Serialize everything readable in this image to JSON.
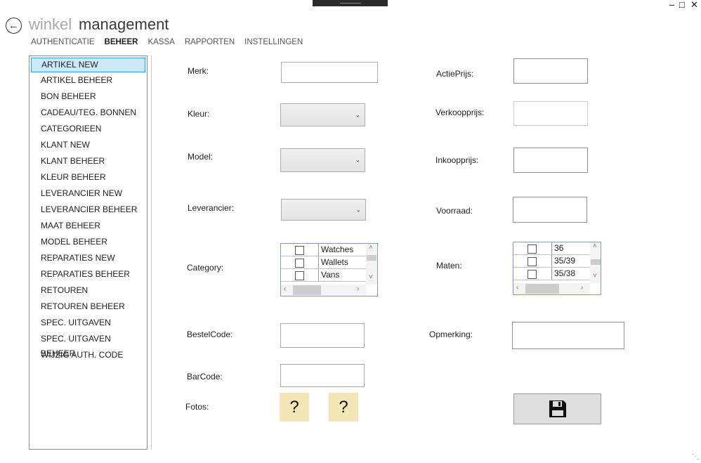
{
  "header": {
    "title_light": "winkel",
    "title_dark": "management",
    "nav": [
      "AUTHENTICATIE",
      "BEHEER",
      "KASSA",
      "RAPPORTEN",
      "INSTELLINGEN"
    ],
    "active_nav": "BEHEER"
  },
  "window": {
    "minimize": "–",
    "maximize": "□",
    "close": "✕"
  },
  "sidebar": {
    "items": [
      "ARTIKEL NEW",
      "ARTIKEL BEHEER",
      "BON BEHEER",
      "CADEAU/TEG. BONNEN",
      "CATEGORIEEN",
      "KLANT NEW",
      "KLANT BEHEER",
      "KLEUR BEHEER",
      "LEVERANCIER NEW",
      "LEVERANCIER BEHEER",
      "MAAT BEHEER",
      "MODEL BEHEER",
      "REPARATIES NEW",
      "REPARATIES BEHEER",
      "RETOUREN",
      "RETOUREN BEHEER",
      "SPEC. UITGAVEN",
      "SPEC. UITGAVEN BEHEER",
      "WIJZIG AUTH. CODE"
    ],
    "selected": "ARTIKEL NEW"
  },
  "form": {
    "merk": "Merk:",
    "kleur": "Kleur:",
    "model": "Model:",
    "leverancier": "Leverancier:",
    "category": "Category:",
    "bestelcode": "BestelCode:",
    "barcode": "BarCode:",
    "fotos": "Fotos:",
    "actieprijs": "ActiePrijs:",
    "verkoopprijs": "Verkoopprijs:",
    "inkoopprijs": "Inkoopprijs:",
    "voorraad": "Voorraad:",
    "maten": "Maten:",
    "opmerking": "Opmerking:"
  },
  "category_list": [
    "Watches",
    "Wallets",
    "Vans"
  ],
  "maten_list": [
    "36",
    "35/39",
    "35/38"
  ],
  "photos": [
    "?",
    "?"
  ],
  "icons": {
    "back": "arrow-left-icon",
    "save": "floppy-disk-icon"
  }
}
